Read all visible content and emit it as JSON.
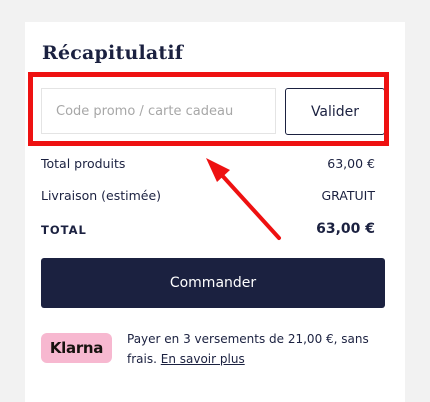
{
  "summary": {
    "title": "Récapitulatif"
  },
  "promo": {
    "placeholder": "Code promo / carte cadeau",
    "value": "",
    "validate_label": "Valider"
  },
  "totals": {
    "products_label": "Total produits",
    "products_value": "63,00 €",
    "shipping_label": "Livraison (estimée)",
    "shipping_value": "GRATUIT",
    "total_label": "TOTAL",
    "total_value": "63,00 €"
  },
  "checkout": {
    "order_label": "Commander"
  },
  "klarna": {
    "badge": "Klarna",
    "text": "Payer en 3 versements de 21,00 €, sans frais.",
    "link": "En savoir plus"
  },
  "annotation": {
    "color": "#ee1111"
  },
  "colors": {
    "brand_navy": "#1b2140",
    "klarna_pink": "#f7b8d0"
  }
}
